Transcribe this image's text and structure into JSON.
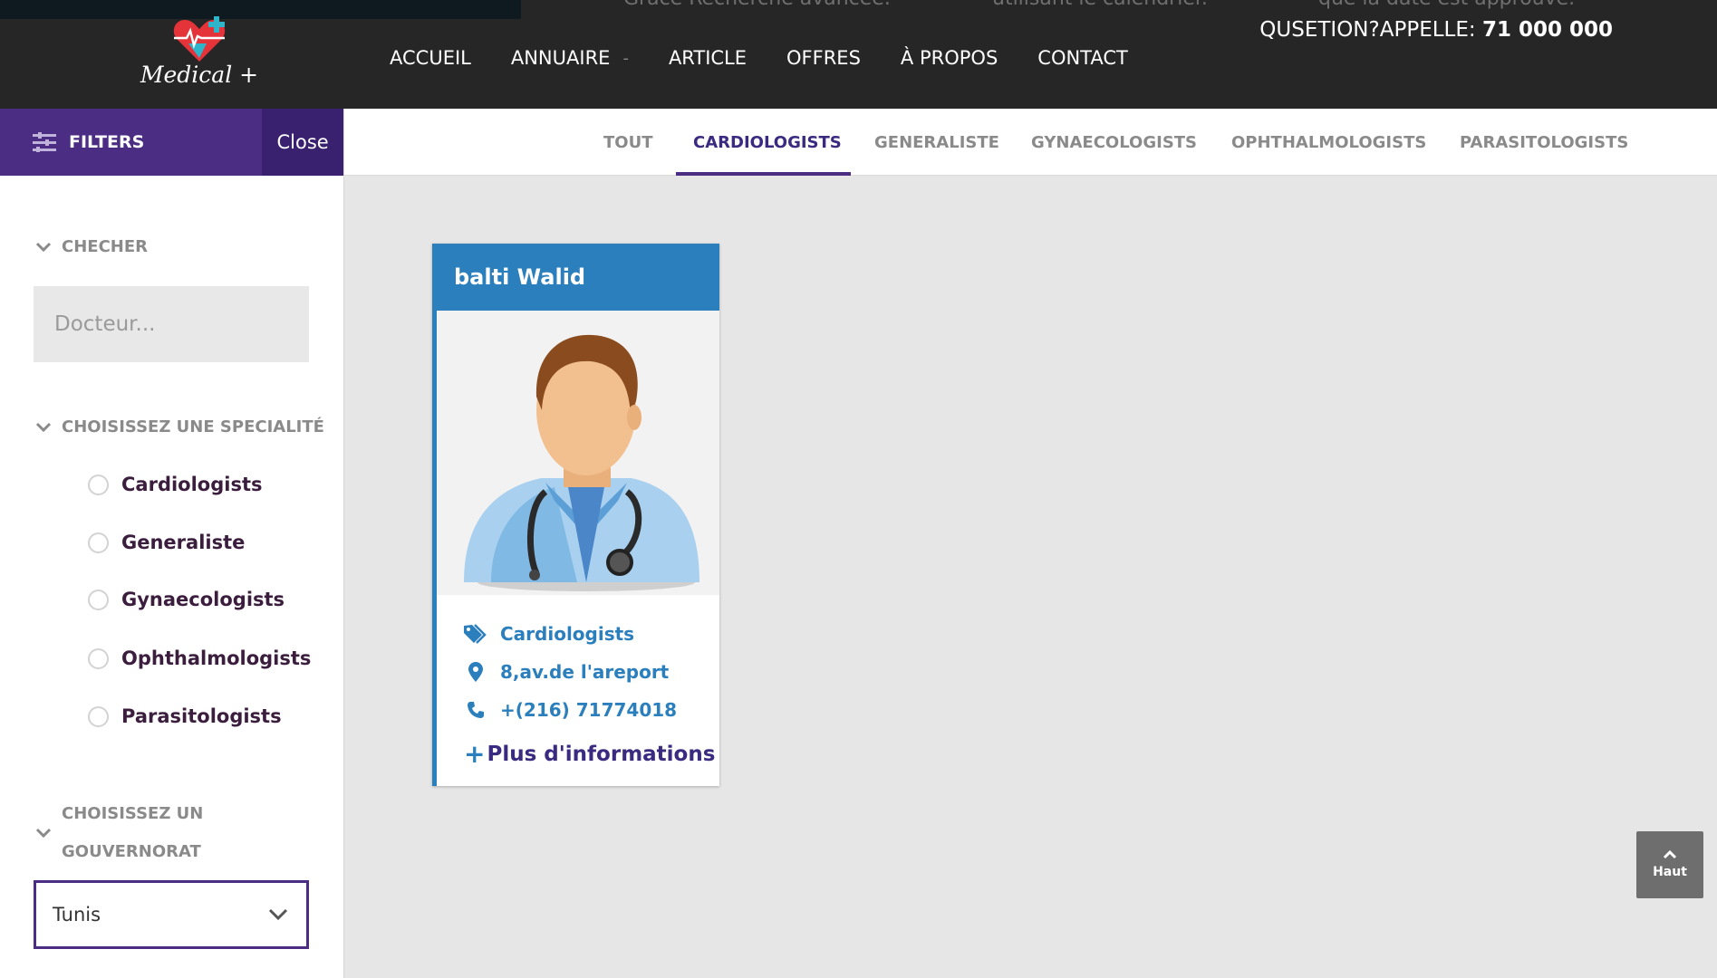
{
  "header": {
    "ghost_texts": [
      "Grâce Recherche avancée.",
      "utilisant le calendrier.",
      "que la date est approuvé."
    ],
    "logo_text": "Medical +",
    "nav": [
      {
        "label": "ACCUEIL"
      },
      {
        "label": "ANNUAIRE",
        "caret": "-"
      },
      {
        "label": "ARTICLE"
      },
      {
        "label": "OFFRES"
      },
      {
        "label": "À PROPOS"
      },
      {
        "label": "CONTACT"
      }
    ],
    "phone_label": "QUSETION?APPELLE:",
    "phone_number": "71 000 000"
  },
  "sidebar": {
    "filters_label": "FILTERS",
    "close_label": "Close",
    "search_section_title": "CHECHER",
    "search_placeholder": "Docteur...",
    "specialty_section_title": "CHOISISSEZ UNE SPECIALITÉ",
    "specialties": [
      "Cardiologists",
      "Generaliste",
      "Gynaecologists",
      "Ophthalmologists",
      "Parasitologists"
    ],
    "gov_title_line1": "CHOISISSEZ UN",
    "gov_title_line2": "GOUVERNORAT",
    "gov_selected": "Tunis"
  },
  "tabs": [
    "TOUT",
    "CARDIOLOGISTS",
    "GENERALISTE",
    "GYNAECOLOGISTS",
    "OPHTHALMOLOGISTS",
    "PARASITOLOGISTS"
  ],
  "active_tab": "CARDIOLOGISTS",
  "card": {
    "name": "balti Walid",
    "specialty": "Cardiologists",
    "address": "8,av.de l'areport",
    "phone": "+(216) 71774018",
    "more": "Plus d'informations"
  },
  "back_to_top": "Haut",
  "colors": {
    "header_bg": "#262626",
    "purple": "#4b2d84",
    "blue": "#2b7fbd",
    "content_bg": "#e6e6e6"
  }
}
